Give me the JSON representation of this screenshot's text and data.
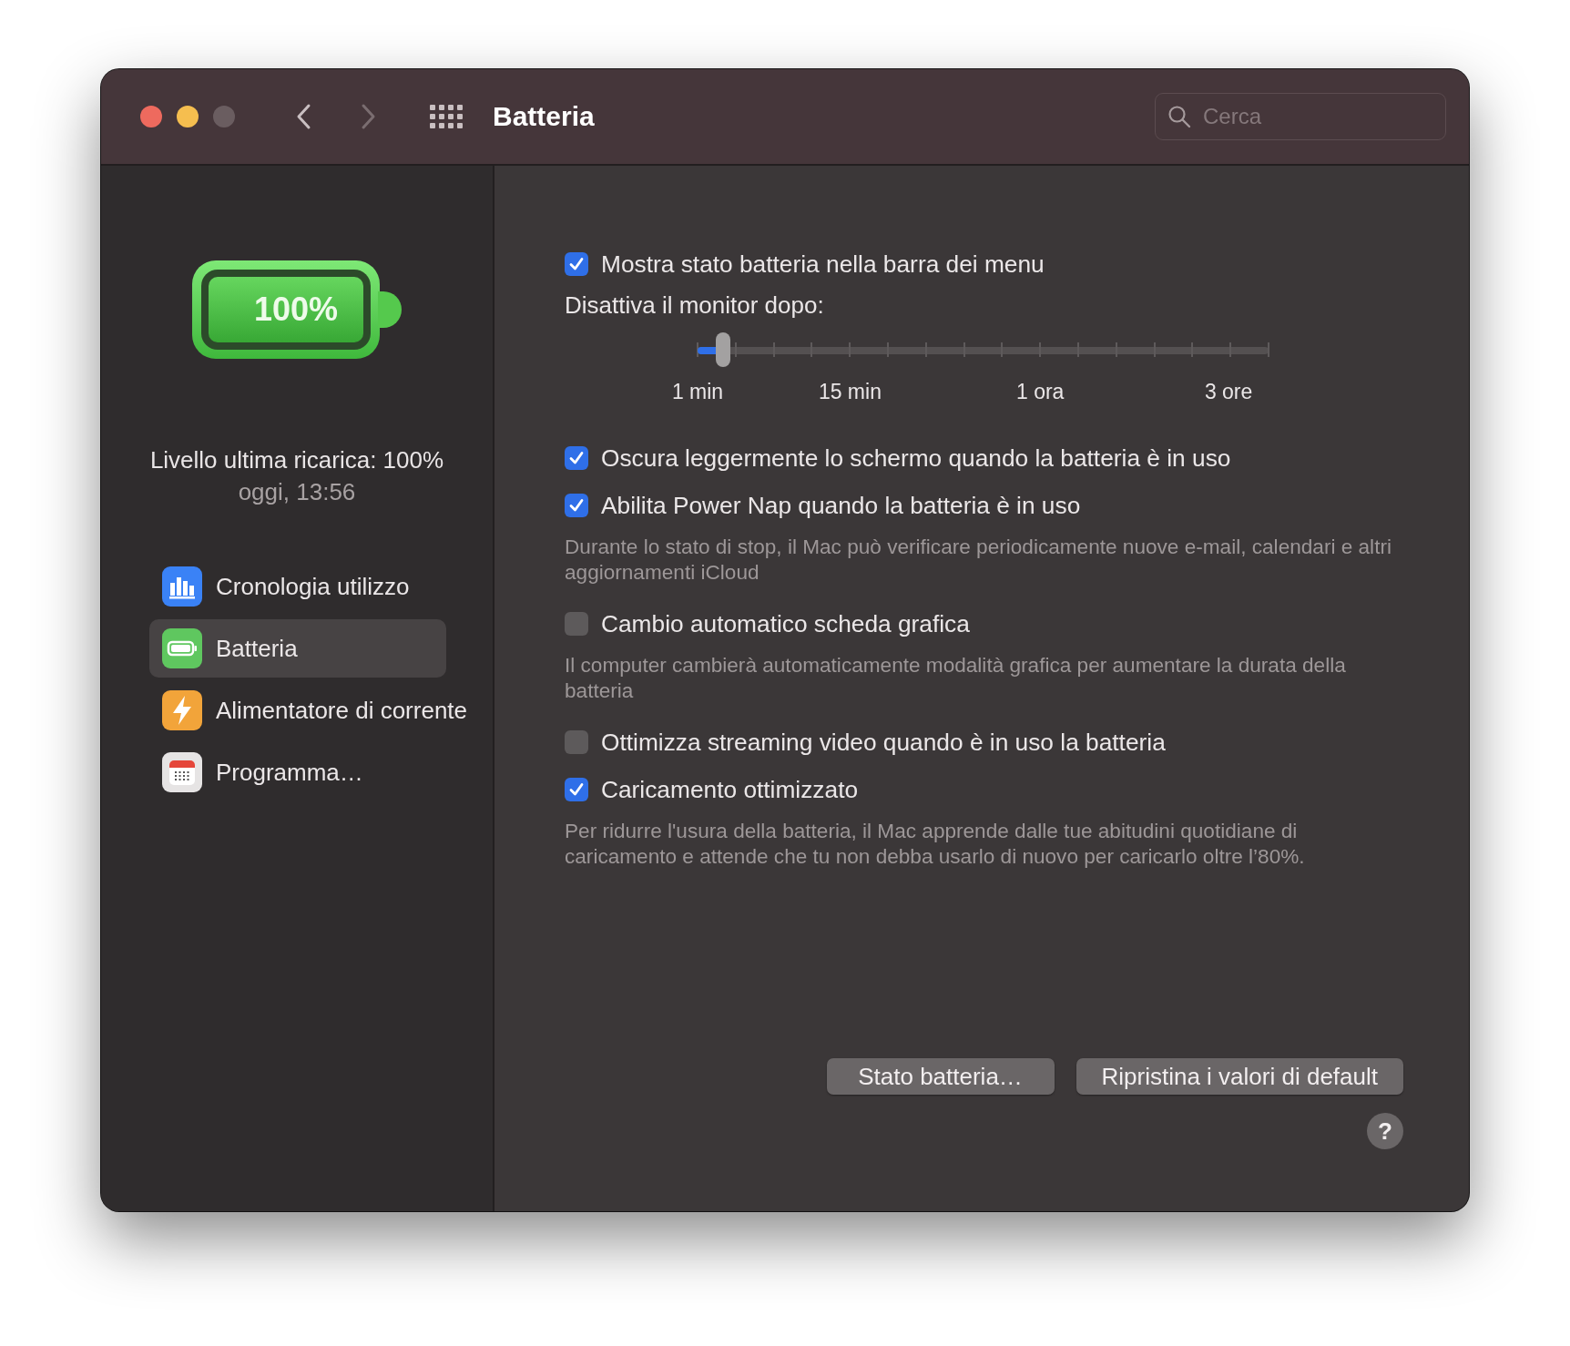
{
  "window": {
    "title": "Batteria"
  },
  "search": {
    "placeholder": "Cerca"
  },
  "sidebar": {
    "battery_badge": "100%",
    "last_charge": "Livello ultima ricarica: 100%",
    "last_charge_time": "oggi, 13:56",
    "items": [
      {
        "label": "Cronologia utilizzo",
        "kind": "usage",
        "selected": false
      },
      {
        "label": "Batteria",
        "kind": "battery",
        "selected": true
      },
      {
        "label": "Alimentatore di corrente",
        "kind": "power",
        "selected": false
      },
      {
        "label": "Programma…",
        "kind": "schedule",
        "selected": false
      }
    ]
  },
  "settings": [
    {
      "kind": "checkbox",
      "label": "Mostra stato batteria nella barra dei menu",
      "checked": true
    },
    {
      "kind": "slider",
      "label": "Disattiva il monitor dopo:",
      "level": 0.045,
      "ticks": [
        "1 min",
        "15 min",
        "1 ora",
        "3 ore"
      ]
    },
    {
      "kind": "checkbox",
      "label": "Oscura leggermente lo schermo quando la batteria è in uso",
      "checked": true
    },
    {
      "kind": "checkbox",
      "label": "Abilita Power Nap quando la batteria è in uso",
      "checked": true
    },
    {
      "kind": "note",
      "text": "Durante lo stato di stop, il Mac può verificare periodicamente nuove e-mail, calendari e altri aggiornamenti iCloud"
    },
    {
      "kind": "checkbox",
      "label": "Cambio automatico scheda grafica",
      "checked": false
    },
    {
      "kind": "note",
      "text": "Il computer cambierà automaticamente modalità grafica per aumentare la durata della batteria"
    },
    {
      "kind": "checkbox",
      "label": "Ottimizza streaming video quando è in uso la batteria",
      "checked": false
    },
    {
      "kind": "checkbox",
      "label": "Caricamento ottimizzato",
      "checked": true
    },
    {
      "kind": "note",
      "text": "Per ridurre l'usura della batteria, il Mac apprende dalle tue abitudini quotidiane di caricamento e attende che tu non debba usarlo di nuovo per caricarlo oltre l’80%."
    }
  ],
  "buttons": [
    "Stato batteria…",
    "Ripristina i valori di default"
  ],
  "help": "?"
}
